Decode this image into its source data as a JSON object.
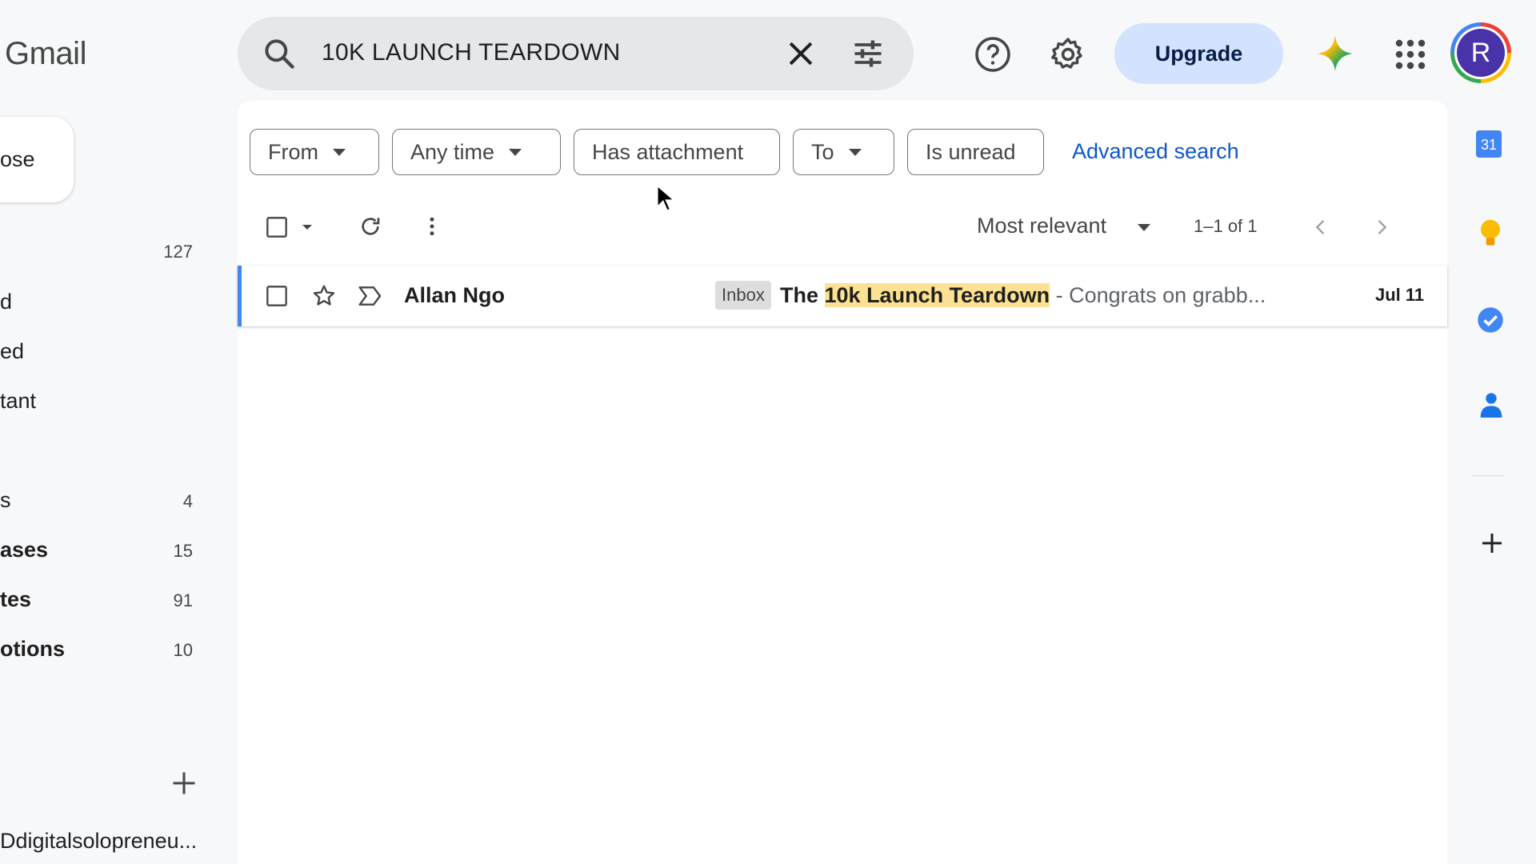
{
  "app": {
    "logo_text": "Gmail"
  },
  "search": {
    "query": "10K LAUNCH TEARDOWN"
  },
  "header": {
    "upgrade_label": "Upgrade",
    "avatar_letter": "R"
  },
  "nav": {
    "compose_label": "ose",
    "items": [
      {
        "label": "",
        "count": "127",
        "bold": false
      },
      {
        "label": "d",
        "count": "",
        "bold": false
      },
      {
        "label": "ed",
        "count": "",
        "bold": false
      },
      {
        "label": "tant",
        "count": "",
        "bold": false
      },
      {
        "label": "s",
        "count": "4",
        "bold": false
      },
      {
        "label": "ases",
        "count": "15",
        "bold": true
      },
      {
        "label": "tes",
        "count": "91",
        "bold": true
      },
      {
        "label": "otions",
        "count": "10",
        "bold": true
      }
    ],
    "account_email": "Ddigitalsolopreneu..."
  },
  "filters": {
    "chips": [
      "From",
      "Any time",
      "Has attachment",
      "To",
      "Is unread"
    ],
    "advanced_search": "Advanced search"
  },
  "toolbar": {
    "sort_label": "Most relevant",
    "paging": "1–1 of 1"
  },
  "results": [
    {
      "sender": "Allan Ngo",
      "label_badge": "Inbox",
      "subject_prefix": "The ",
      "subject_highlight": "10k Launch Teardown",
      "snippet": " - Congrats on grabb...",
      "date": "Jul 11"
    }
  ],
  "side_panel": {
    "calendar_day": "31",
    "icons": [
      "calendar-icon",
      "keep-icon",
      "tasks-icon",
      "contacts-icon",
      "add-icon"
    ]
  },
  "colors": {
    "accent_blue": "#0b57d0",
    "upgrade_bg": "#d3e3fd",
    "highlight": "#fde293",
    "avatar_bg": "#4a32a8"
  }
}
